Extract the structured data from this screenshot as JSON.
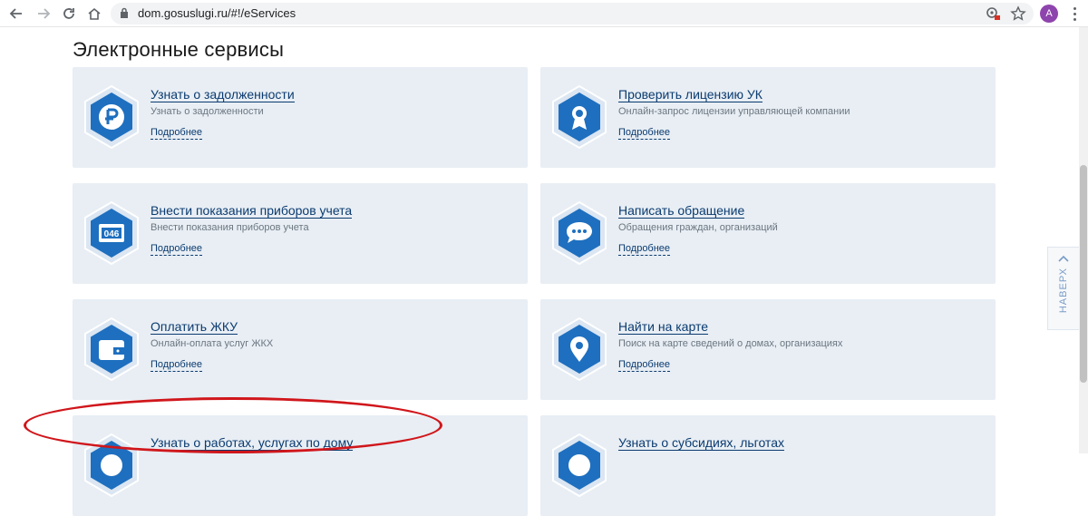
{
  "browser": {
    "url": "dom.gosuslugi.ru/#!/eServices",
    "avatar_letter": "A"
  },
  "page": {
    "title": "Электронные сервисы",
    "scroll_top_label": "НАВЕРХ"
  },
  "cards": [
    {
      "title": "Узнать о задолженности",
      "desc": "Узнать о задолженности",
      "more": "Подробнее",
      "icon": "ruble-icon"
    },
    {
      "title": "Проверить лицензию УК",
      "desc": "Онлайн-запрос лицензии управляющей компании",
      "more": "Подробнее",
      "icon": "award-icon"
    },
    {
      "title": "Внести показания приборов учета",
      "desc": "Внести показания приборов учета",
      "more": "Подробнее",
      "icon": "meter-icon"
    },
    {
      "title": "Написать обращение",
      "desc": "Обращения граждан, организаций",
      "more": "Подробнее",
      "icon": "chat-icon"
    },
    {
      "title": "Оплатить ЖКУ",
      "desc": "Онлайн-оплата услуг ЖКХ",
      "more": "Подробнее",
      "icon": "wallet-icon"
    },
    {
      "title": "Найти на карте",
      "desc": "Поиск на карте сведений о домах, организациях",
      "more": "Подробнее",
      "icon": "map-pin-icon"
    },
    {
      "title": "Узнать о работах, услугах по дому",
      "desc": "",
      "more": "",
      "icon": "works-icon"
    },
    {
      "title": "Узнать о субсидиях, льготах",
      "desc": "",
      "more": "",
      "icon": "subsidy-icon"
    }
  ],
  "colors": {
    "card_bg": "#e8eef4",
    "hex_fill": "#1e6fbf",
    "link": "#0b3b70",
    "annotation": "#d0161b"
  }
}
